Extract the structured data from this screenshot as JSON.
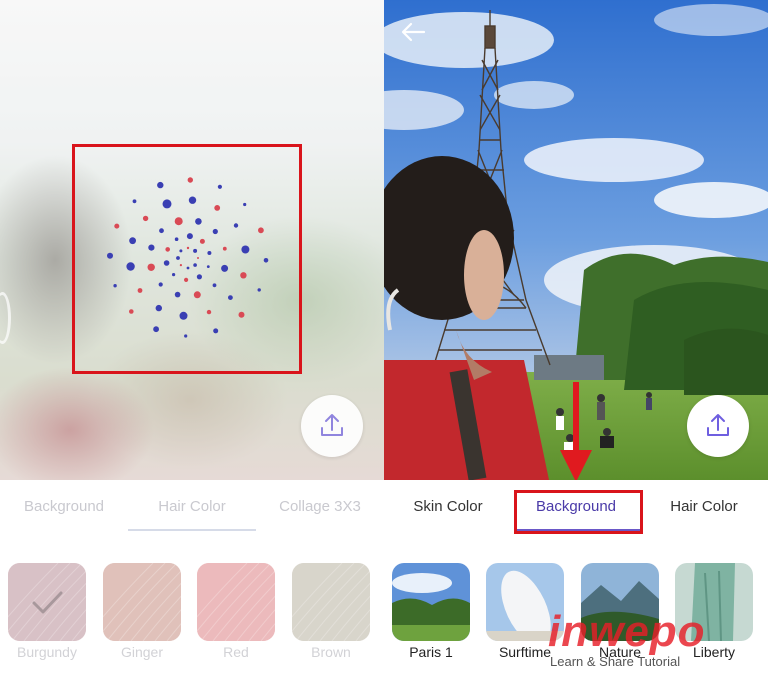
{
  "left_panel": {
    "tabs": [
      {
        "label": "Background",
        "active": false
      },
      {
        "label": "Hair Color",
        "active": true
      },
      {
        "label": "Collage 3X3",
        "active": false
      }
    ],
    "swatches": [
      {
        "label": "Burgundy",
        "color": "#b98e97",
        "selected": true
      },
      {
        "label": "Ginger",
        "color": "#c78f82",
        "selected": false
      },
      {
        "label": "Red",
        "color": "#dd8285",
        "selected": false
      },
      {
        "label": "Brown",
        "color": "#b9b2a1",
        "selected": false
      }
    ],
    "share_icon": "upload-icon",
    "state": "processing"
  },
  "right_panel": {
    "tabs": [
      {
        "label": "Skin Color",
        "active": false
      },
      {
        "label": "Background",
        "active": true
      },
      {
        "label": "Hair Color",
        "active": false
      }
    ],
    "backgrounds": [
      {
        "label": "Paris 1"
      },
      {
        "label": "Surftime"
      },
      {
        "label": "Nature"
      },
      {
        "label": "Liberty"
      }
    ],
    "back_icon": "arrow-left-icon",
    "share_icon": "upload-icon"
  },
  "watermark": {
    "logo": "inwepo",
    "tagline": "Learn & Share Tutorial"
  },
  "colors": {
    "accent": "#5b4bc4",
    "annotation_red": "#d9141b"
  }
}
